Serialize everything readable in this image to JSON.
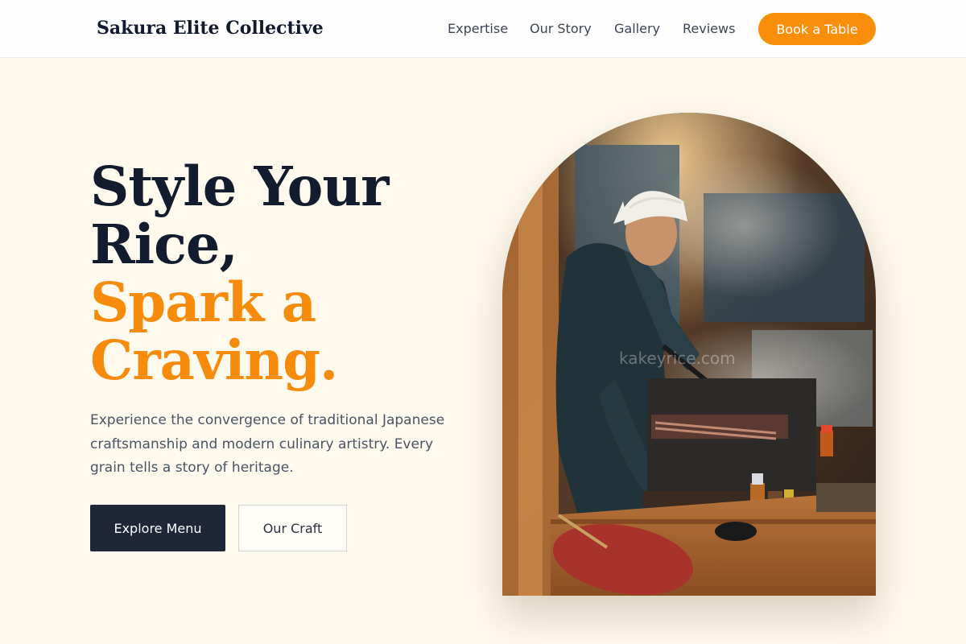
{
  "header": {
    "brand": "Sakura Elite Collective",
    "nav": [
      "Expertise",
      "Our Story",
      "Gallery",
      "Reviews"
    ],
    "cta_label": "Book a Table"
  },
  "hero": {
    "headline_line1": "Style Your",
    "headline_line2": "Rice,",
    "accent_line1": "Spark a",
    "accent_line2": "Craving.",
    "description": "Experience the convergence of traditional Japanese craftsmanship and modern culinary artistry. Every grain tells a story of heritage.",
    "primary_button": "Explore Menu",
    "secondary_button": "Our Craft",
    "image_watermark": "kakeyrice.com"
  },
  "colors": {
    "accent": "#f88e0a",
    "navy": "#1e2638",
    "background": "#fefaee"
  }
}
